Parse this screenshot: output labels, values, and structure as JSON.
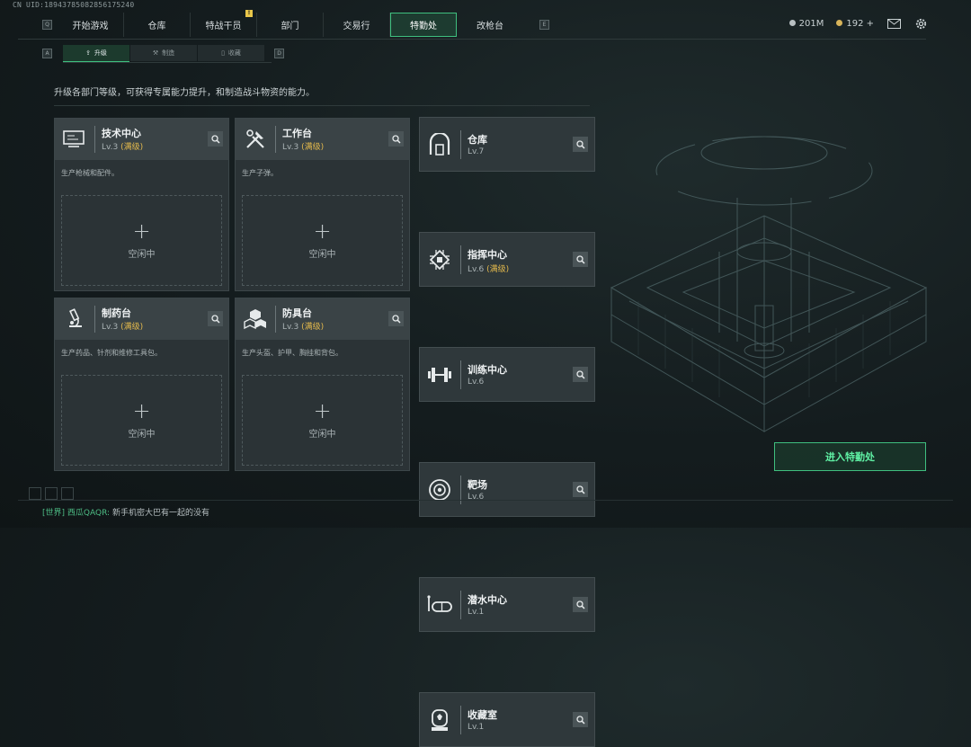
{
  "uid": "CN UID:18943785082856175240",
  "nav": {
    "left_key": "Q",
    "right_key": "E",
    "tabs": [
      {
        "label": "开始游戏",
        "active": false
      },
      {
        "label": "仓库",
        "active": false
      },
      {
        "label": "特战干员",
        "active": false,
        "badge": "!"
      },
      {
        "label": "部门",
        "active": false
      },
      {
        "label": "交易行",
        "active": false
      },
      {
        "label": "特勤处",
        "active": true
      },
      {
        "label": "改枪台",
        "active": false
      }
    ]
  },
  "currency": {
    "money": "201M",
    "points": "192 +"
  },
  "subnav": {
    "left_key": "A",
    "right_key": "D",
    "tabs": [
      {
        "label": "升级",
        "active": true
      },
      {
        "label": "制造",
        "active": false
      },
      {
        "label": "收藏",
        "active": false
      }
    ]
  },
  "description": "升级各部门等级，可获得专属能力提升，和制造战斗物资的能力。",
  "cards": [
    {
      "title": "技术中心",
      "level": "Lv.3",
      "status": "(满级)",
      "desc": "生产枪械和配件。",
      "slot": "空闲中"
    },
    {
      "title": "工作台",
      "level": "Lv.3",
      "status": "(满级)",
      "desc": "生产子弹。",
      "slot": "空闲中"
    },
    {
      "title": "制药台",
      "level": "Lv.3",
      "status": "(满级)",
      "desc": "生产药品、针剂和维修工具包。",
      "slot": "空闲中"
    },
    {
      "title": "防具台",
      "level": "Lv.3",
      "status": "(满级)",
      "desc": "生产头盔、护甲、胸挂和背包。",
      "slot": "空闲中"
    }
  ],
  "facilities": [
    {
      "title": "仓库",
      "level": "Lv.7",
      "status": ""
    },
    {
      "title": "指挥中心",
      "level": "Lv.6",
      "status": "(满级)"
    },
    {
      "title": "训练中心",
      "level": "Lv.6",
      "status": ""
    },
    {
      "title": "靶场",
      "level": "Lv.6",
      "status": ""
    },
    {
      "title": "潜水中心",
      "level": "Lv.1",
      "status": ""
    },
    {
      "title": "收藏室",
      "level": "Lv.1",
      "status": ""
    }
  ],
  "enter_button": "进入特勤处",
  "chat": {
    "channel": "[世界]",
    "user": "西瓜QAQR:",
    "message": "新手机密大巴有一起的没有"
  },
  "colors": {
    "accent": "#3fbf7f",
    "max_level": "#e3b94c",
    "badge": "#e8c64a"
  }
}
